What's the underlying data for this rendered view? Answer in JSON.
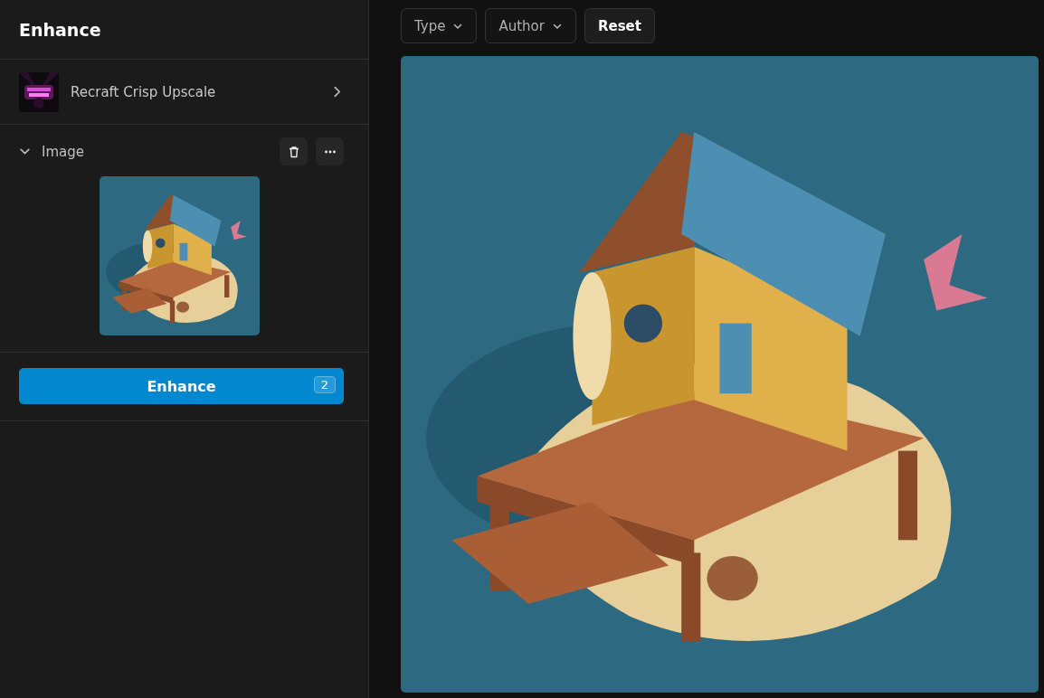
{
  "panel": {
    "title": "Enhance"
  },
  "model": {
    "name": "Recraft Crisp Upscale"
  },
  "image_section": {
    "label": "Image",
    "expanded": true
  },
  "enhance_button": {
    "label": "Enhance",
    "badge": "2"
  },
  "filters": [
    {
      "label": "Type",
      "kind": "dropdown"
    },
    {
      "label": "Author",
      "kind": "dropdown"
    },
    {
      "label": "Reset",
      "kind": "button"
    }
  ]
}
